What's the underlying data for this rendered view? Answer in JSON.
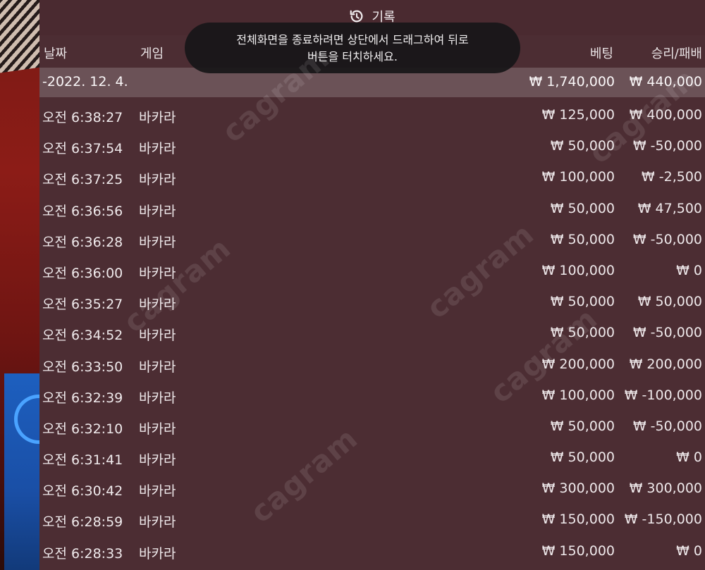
{
  "header": {
    "title": "기록",
    "title_icon": "history-icon"
  },
  "columns": {
    "date": "날짜",
    "game": "게임",
    "bet": "베팅",
    "result": "승리/패배"
  },
  "toast": {
    "line1": "전체화면을 종료하려면 상단에서 드래그하여 뒤로",
    "line2": "버튼을 터치하세요."
  },
  "summary": {
    "date": "-2022. 12. 4.",
    "bet": "₩ 1,740,000",
    "result": "₩ 440,000"
  },
  "rows": [
    {
      "time": "오전 6:38:27",
      "game": "바카라",
      "bet": "₩ 125,000",
      "result": "₩ 400,000"
    },
    {
      "time": "오전 6:37:54",
      "game": "바카라",
      "bet": "₩ 50,000",
      "result": "₩ -50,000"
    },
    {
      "time": "오전 6:37:25",
      "game": "바카라",
      "bet": "₩ 100,000",
      "result": "₩ -2,500"
    },
    {
      "time": "오전 6:36:56",
      "game": "바카라",
      "bet": "₩ 50,000",
      "result": "₩ 47,500"
    },
    {
      "time": "오전 6:36:28",
      "game": "바카라",
      "bet": "₩ 50,000",
      "result": "₩ -50,000"
    },
    {
      "time": "오전 6:36:00",
      "game": "바카라",
      "bet": "₩ 100,000",
      "result": "₩ 0"
    },
    {
      "time": "오전 6:35:27",
      "game": "바카라",
      "bet": "₩ 50,000",
      "result": "₩ 50,000"
    },
    {
      "time": "오전 6:34:52",
      "game": "바카라",
      "bet": "₩ 50,000",
      "result": "₩ -50,000"
    },
    {
      "time": "오전 6:33:50",
      "game": "바카라",
      "bet": "₩ 200,000",
      "result": "₩ 200,000"
    },
    {
      "time": "오전 6:32:39",
      "game": "바카라",
      "bet": "₩ 100,000",
      "result": "₩ -100,000"
    },
    {
      "time": "오전 6:32:10",
      "game": "바카라",
      "bet": "₩ 50,000",
      "result": "₩ -50,000"
    },
    {
      "time": "오전 6:31:41",
      "game": "바카라",
      "bet": "₩ 50,000",
      "result": "₩ 0"
    },
    {
      "time": "오전 6:30:42",
      "game": "바카라",
      "bet": "₩ 300,000",
      "result": "₩ 300,000"
    },
    {
      "time": "오전 6:28:59",
      "game": "바카라",
      "bet": "₩ 150,000",
      "result": "₩ -150,000"
    },
    {
      "time": "오전 6:28:33",
      "game": "바카라",
      "bet": "₩ 150,000",
      "result": "₩ 0"
    }
  ],
  "watermark": "cagram"
}
